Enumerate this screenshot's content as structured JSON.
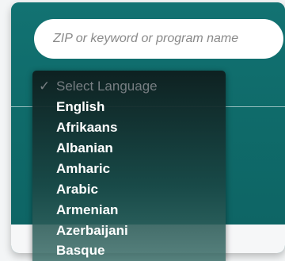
{
  "search": {
    "placeholder": "ZIP or keyword or program name"
  },
  "language_select": {
    "selected": "Select Language",
    "check_glyph": "✓",
    "options": [
      "English",
      "Afrikaans",
      "Albanian",
      "Amharic",
      "Arabic",
      "Armenian",
      "Azerbaijani",
      "Basque"
    ]
  },
  "colors": {
    "teal": "#0f6d6d",
    "dropdown_bg": "#0f1f1f",
    "text": "#ffffff"
  }
}
